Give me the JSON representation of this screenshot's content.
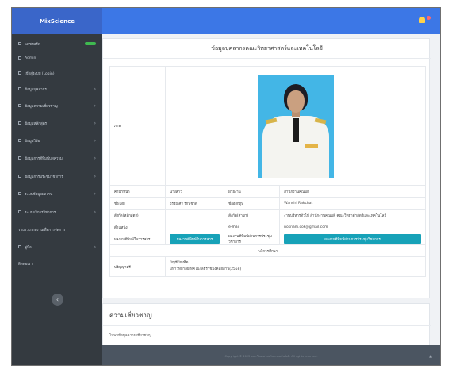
{
  "app": {
    "brand": "MixScience"
  },
  "sidebar": {
    "items": [
      {
        "label": "แดชบอร์ด",
        "has_badge": true
      },
      {
        "label": "Admin"
      },
      {
        "label": "เข้าสู่ระบบ (Login)"
      },
      {
        "label": "ข้อมูลบุคลากร",
        "chevron": true
      },
      {
        "label": "ข้อมูลความเชี่ยวชาญ",
        "chevron": true
      },
      {
        "label": "ข้อมูลหลักสูตร",
        "chevron": true
      },
      {
        "label": "ข้อมูลวิจัย",
        "chevron": true
      },
      {
        "label": "ข้อมูลการตีพิมพ์บทความ",
        "chevron": true
      },
      {
        "label": "ข้อมูลการประชุมวิชาการ",
        "chevron": true
      },
      {
        "label": "ระบบข้อมูลผลงาน",
        "chevron": true
      },
      {
        "label": "ระบบบริการวิชาการ",
        "chevron": true
      },
      {
        "label": "รวบรวมรายงานเพื่อการจัดการ"
      },
      {
        "label": "คู่มือ",
        "chevron": true
      },
      {
        "label": "ติดต่อเรา"
      }
    ],
    "collapse_glyph": "‹"
  },
  "profile": {
    "title": "ข้อมูลบุคลากรคณะวิทยาศาสตร์และเทคโนโลยี",
    "photo_label": "ภาพ",
    "rows": [
      {
        "l1": "คำนำหน้า",
        "v1": "นางสาว",
        "l2": "ฝ่ายงาน",
        "v2": "สำนักงานคณบดี"
      },
      {
        "l1": "ชื่อไทย",
        "v1": "วรรณศิริ รักษ์ชาติ",
        "l2": "ชื่ออังกฤษ",
        "v2": "Wansiri Rakchat"
      },
      {
        "l1": "สังกัด(หลักสูตร)",
        "v1": "",
        "l2": "สังกัด(สาขา)",
        "v2": "งานบริหารทั่วไป สำนักงานคณบดี คณะวิทยาศาสตร์และเทคโนโลยี"
      },
      {
        "l1": "ตำแหน่ง",
        "v1": "",
        "l2": "e-mail",
        "v2": "nosnam.cok@gmail.com"
      }
    ],
    "publish_label": "ผลงานตีพิมพ์ในวารสาร",
    "publish_button": "ผลงานตีพิมพ์ในวารสาร",
    "conference_label": "ผลงานตีพิมพ์ผ่านการประชุมวิชาการ",
    "conference_button": "ผลงานตีพิมพ์ผ่านการประชุมวิชาการ",
    "education_header": "วุฒิการศึกษา",
    "degree_label": "ปริญญาตรี",
    "degree_line1": "บัญชีบัณฑิต",
    "degree_line2": "มหาวิทยาลัยเทคโนโลยีราชมงคลอีสาน(2558)"
  },
  "expertise": {
    "title": "ความเชี่ยวชาญ",
    "empty_text": "ไม่พบข้อมูลความเชี่ยวชาญ"
  },
  "footer": {
    "text": "Copyright © 2023 คณะวิทยาศาสตร์และเทคโนโลยี. All rights reserved.",
    "up_glyph": "▲"
  }
}
